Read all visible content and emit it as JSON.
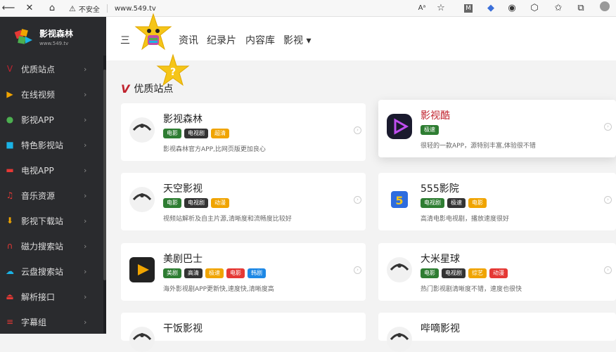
{
  "browser": {
    "security": "不安全",
    "url": "www.549.tv"
  },
  "sidebar": {
    "logo_name": "影视森林",
    "logo_url": "www.549.tv",
    "items": [
      {
        "label": "优质站点",
        "icon": "v-logo-icon",
        "color": "#c0232e"
      },
      {
        "label": "在线视频",
        "icon": "play-icon",
        "color": "#f0a400"
      },
      {
        "label": "影视APP",
        "icon": "apple-icon",
        "color": "#4caf50"
      },
      {
        "label": "特色影视站",
        "icon": "camera-icon",
        "color": "#1ab3e6"
      },
      {
        "label": "电视APP",
        "icon": "tv-icon",
        "color": "#e53935"
      },
      {
        "label": "音乐资源",
        "icon": "music-icon",
        "color": "#e53935"
      },
      {
        "label": "影视下载站",
        "icon": "download-icon",
        "color": "#f0a400"
      },
      {
        "label": "磁力搜索站",
        "icon": "magnet-icon",
        "color": "#e53935"
      },
      {
        "label": "云盘搜索站",
        "icon": "cloud-icon",
        "color": "#1ab3e6"
      },
      {
        "label": "解析接口",
        "icon": "interface-icon",
        "color": "#e53935"
      },
      {
        "label": "字幕组",
        "icon": "subtitle-icon",
        "color": "#e53935"
      }
    ]
  },
  "topnav": {
    "items": [
      "三",
      "五",
      "资讯",
      "纪录片",
      "内容库",
      "影视 ▾"
    ]
  },
  "section": {
    "title": "优质站点"
  },
  "cards": [
    {
      "title": "影视森林",
      "tags": [
        {
          "t": "电影",
          "c": "#2e7d32"
        },
        {
          "t": "电视剧",
          "c": "#333"
        },
        {
          "t": "超清",
          "c": "#f0a400"
        }
      ],
      "desc": "影视森林官方APP,比网页版更加良心",
      "highlight": false
    },
    {
      "title": "影视酷",
      "tags": [
        {
          "t": "极速",
          "c": "#2e7d32"
        }
      ],
      "desc": "很轻的一款APP，源特别丰富,体验很不错",
      "highlight": true
    },
    {
      "title": "天空影视",
      "tags": [
        {
          "t": "电影",
          "c": "#2e7d32"
        },
        {
          "t": "电视剧",
          "c": "#333"
        },
        {
          "t": "动漫",
          "c": "#f0a400"
        }
      ],
      "desc": "视频站解析及自主片源,清晰度和流畅度比较好",
      "highlight": false
    },
    {
      "title": "555影院",
      "tags": [
        {
          "t": "电视剧",
          "c": "#2e7d32"
        },
        {
          "t": "极速",
          "c": "#333"
        },
        {
          "t": "电影",
          "c": "#f0a400"
        }
      ],
      "desc": "高清电影电视剧，播放速度很好",
      "highlight": false
    },
    {
      "title": "美剧巴士",
      "tags": [
        {
          "t": "美剧",
          "c": "#2e7d32"
        },
        {
          "t": "高清",
          "c": "#333"
        },
        {
          "t": "极速",
          "c": "#f0a400"
        },
        {
          "t": "电影",
          "c": "#e53935"
        },
        {
          "t": "韩剧",
          "c": "#1e88e5"
        }
      ],
      "desc": "海外影视剧APP更新快,速度快,清晰度高",
      "highlight": false
    },
    {
      "title": "大米星球",
      "tags": [
        {
          "t": "电影",
          "c": "#2e7d32"
        },
        {
          "t": "电视剧",
          "c": "#333"
        },
        {
          "t": "综艺",
          "c": "#f0a400"
        },
        {
          "t": "动漫",
          "c": "#e53935"
        }
      ],
      "desc": "热门影视剧清晰度不错，速度也很快",
      "highlight": false
    },
    {
      "title": "干饭影视",
      "tags": [],
      "desc": "",
      "highlight": false
    },
    {
      "title": "哔嘀影视",
      "tags": [],
      "desc": "",
      "highlight": false
    }
  ]
}
